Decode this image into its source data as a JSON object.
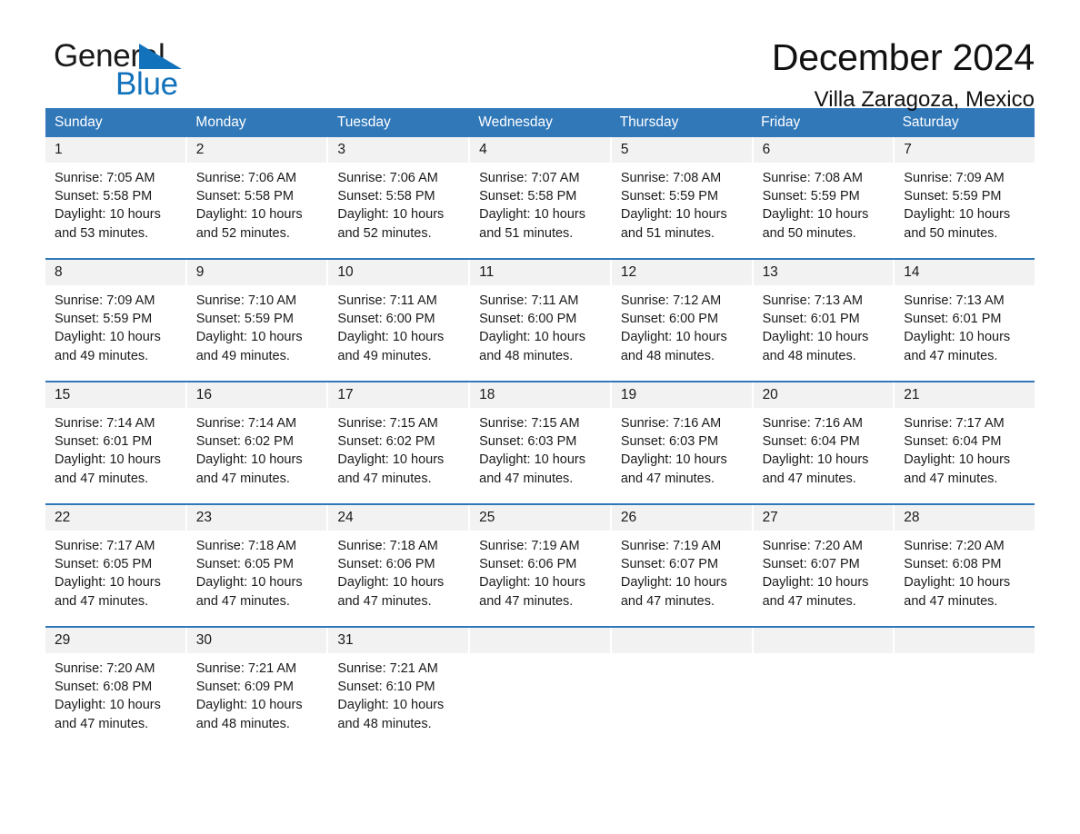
{
  "brand": {
    "name_part1": "General",
    "name_part2": "Blue",
    "accent_color": "#1272bb"
  },
  "header": {
    "title": "December 2024",
    "subtitle": "Villa Zaragoza, Mexico"
  },
  "calendar": {
    "header_color": "#3178b9",
    "weekday_headers": [
      "Sunday",
      "Monday",
      "Tuesday",
      "Wednesday",
      "Thursday",
      "Friday",
      "Saturday"
    ],
    "weeks": [
      [
        {
          "day": "1",
          "sunrise": "Sunrise: 7:05 AM",
          "sunset": "Sunset: 5:58 PM",
          "daylight_line1": "Daylight: 10 hours",
          "daylight_line2": "and 53 minutes."
        },
        {
          "day": "2",
          "sunrise": "Sunrise: 7:06 AM",
          "sunset": "Sunset: 5:58 PM",
          "daylight_line1": "Daylight: 10 hours",
          "daylight_line2": "and 52 minutes."
        },
        {
          "day": "3",
          "sunrise": "Sunrise: 7:06 AM",
          "sunset": "Sunset: 5:58 PM",
          "daylight_line1": "Daylight: 10 hours",
          "daylight_line2": "and 52 minutes."
        },
        {
          "day": "4",
          "sunrise": "Sunrise: 7:07 AM",
          "sunset": "Sunset: 5:58 PM",
          "daylight_line1": "Daylight: 10 hours",
          "daylight_line2": "and 51 minutes."
        },
        {
          "day": "5",
          "sunrise": "Sunrise: 7:08 AM",
          "sunset": "Sunset: 5:59 PM",
          "daylight_line1": "Daylight: 10 hours",
          "daylight_line2": "and 51 minutes."
        },
        {
          "day": "6",
          "sunrise": "Sunrise: 7:08 AM",
          "sunset": "Sunset: 5:59 PM",
          "daylight_line1": "Daylight: 10 hours",
          "daylight_line2": "and 50 minutes."
        },
        {
          "day": "7",
          "sunrise": "Sunrise: 7:09 AM",
          "sunset": "Sunset: 5:59 PM",
          "daylight_line1": "Daylight: 10 hours",
          "daylight_line2": "and 50 minutes."
        }
      ],
      [
        {
          "day": "8",
          "sunrise": "Sunrise: 7:09 AM",
          "sunset": "Sunset: 5:59 PM",
          "daylight_line1": "Daylight: 10 hours",
          "daylight_line2": "and 49 minutes."
        },
        {
          "day": "9",
          "sunrise": "Sunrise: 7:10 AM",
          "sunset": "Sunset: 5:59 PM",
          "daylight_line1": "Daylight: 10 hours",
          "daylight_line2": "and 49 minutes."
        },
        {
          "day": "10",
          "sunrise": "Sunrise: 7:11 AM",
          "sunset": "Sunset: 6:00 PM",
          "daylight_line1": "Daylight: 10 hours",
          "daylight_line2": "and 49 minutes."
        },
        {
          "day": "11",
          "sunrise": "Sunrise: 7:11 AM",
          "sunset": "Sunset: 6:00 PM",
          "daylight_line1": "Daylight: 10 hours",
          "daylight_line2": "and 48 minutes."
        },
        {
          "day": "12",
          "sunrise": "Sunrise: 7:12 AM",
          "sunset": "Sunset: 6:00 PM",
          "daylight_line1": "Daylight: 10 hours",
          "daylight_line2": "and 48 minutes."
        },
        {
          "day": "13",
          "sunrise": "Sunrise: 7:13 AM",
          "sunset": "Sunset: 6:01 PM",
          "daylight_line1": "Daylight: 10 hours",
          "daylight_line2": "and 48 minutes."
        },
        {
          "day": "14",
          "sunrise": "Sunrise: 7:13 AM",
          "sunset": "Sunset: 6:01 PM",
          "daylight_line1": "Daylight: 10 hours",
          "daylight_line2": "and 47 minutes."
        }
      ],
      [
        {
          "day": "15",
          "sunrise": "Sunrise: 7:14 AM",
          "sunset": "Sunset: 6:01 PM",
          "daylight_line1": "Daylight: 10 hours",
          "daylight_line2": "and 47 minutes."
        },
        {
          "day": "16",
          "sunrise": "Sunrise: 7:14 AM",
          "sunset": "Sunset: 6:02 PM",
          "daylight_line1": "Daylight: 10 hours",
          "daylight_line2": "and 47 minutes."
        },
        {
          "day": "17",
          "sunrise": "Sunrise: 7:15 AM",
          "sunset": "Sunset: 6:02 PM",
          "daylight_line1": "Daylight: 10 hours",
          "daylight_line2": "and 47 minutes."
        },
        {
          "day": "18",
          "sunrise": "Sunrise: 7:15 AM",
          "sunset": "Sunset: 6:03 PM",
          "daylight_line1": "Daylight: 10 hours",
          "daylight_line2": "and 47 minutes."
        },
        {
          "day": "19",
          "sunrise": "Sunrise: 7:16 AM",
          "sunset": "Sunset: 6:03 PM",
          "daylight_line1": "Daylight: 10 hours",
          "daylight_line2": "and 47 minutes."
        },
        {
          "day": "20",
          "sunrise": "Sunrise: 7:16 AM",
          "sunset": "Sunset: 6:04 PM",
          "daylight_line1": "Daylight: 10 hours",
          "daylight_line2": "and 47 minutes."
        },
        {
          "day": "21",
          "sunrise": "Sunrise: 7:17 AM",
          "sunset": "Sunset: 6:04 PM",
          "daylight_line1": "Daylight: 10 hours",
          "daylight_line2": "and 47 minutes."
        }
      ],
      [
        {
          "day": "22",
          "sunrise": "Sunrise: 7:17 AM",
          "sunset": "Sunset: 6:05 PM",
          "daylight_line1": "Daylight: 10 hours",
          "daylight_line2": "and 47 minutes."
        },
        {
          "day": "23",
          "sunrise": "Sunrise: 7:18 AM",
          "sunset": "Sunset: 6:05 PM",
          "daylight_line1": "Daylight: 10 hours",
          "daylight_line2": "and 47 minutes."
        },
        {
          "day": "24",
          "sunrise": "Sunrise: 7:18 AM",
          "sunset": "Sunset: 6:06 PM",
          "daylight_line1": "Daylight: 10 hours",
          "daylight_line2": "and 47 minutes."
        },
        {
          "day": "25",
          "sunrise": "Sunrise: 7:19 AM",
          "sunset": "Sunset: 6:06 PM",
          "daylight_line1": "Daylight: 10 hours",
          "daylight_line2": "and 47 minutes."
        },
        {
          "day": "26",
          "sunrise": "Sunrise: 7:19 AM",
          "sunset": "Sunset: 6:07 PM",
          "daylight_line1": "Daylight: 10 hours",
          "daylight_line2": "and 47 minutes."
        },
        {
          "day": "27",
          "sunrise": "Sunrise: 7:20 AM",
          "sunset": "Sunset: 6:07 PM",
          "daylight_line1": "Daylight: 10 hours",
          "daylight_line2": "and 47 minutes."
        },
        {
          "day": "28",
          "sunrise": "Sunrise: 7:20 AM",
          "sunset": "Sunset: 6:08 PM",
          "daylight_line1": "Daylight: 10 hours",
          "daylight_line2": "and 47 minutes."
        }
      ],
      [
        {
          "day": "29",
          "sunrise": "Sunrise: 7:20 AM",
          "sunset": "Sunset: 6:08 PM",
          "daylight_line1": "Daylight: 10 hours",
          "daylight_line2": "and 47 minutes."
        },
        {
          "day": "30",
          "sunrise": "Sunrise: 7:21 AM",
          "sunset": "Sunset: 6:09 PM",
          "daylight_line1": "Daylight: 10 hours",
          "daylight_line2": "and 48 minutes."
        },
        {
          "day": "31",
          "sunrise": "Sunrise: 7:21 AM",
          "sunset": "Sunset: 6:10 PM",
          "daylight_line1": "Daylight: 10 hours",
          "daylight_line2": "and 48 minutes."
        },
        {
          "day": "",
          "sunrise": "",
          "sunset": "",
          "daylight_line1": "",
          "daylight_line2": ""
        },
        {
          "day": "",
          "sunrise": "",
          "sunset": "",
          "daylight_line1": "",
          "daylight_line2": ""
        },
        {
          "day": "",
          "sunrise": "",
          "sunset": "",
          "daylight_line1": "",
          "daylight_line2": ""
        },
        {
          "day": "",
          "sunrise": "",
          "sunset": "",
          "daylight_line1": "",
          "daylight_line2": ""
        }
      ]
    ]
  }
}
